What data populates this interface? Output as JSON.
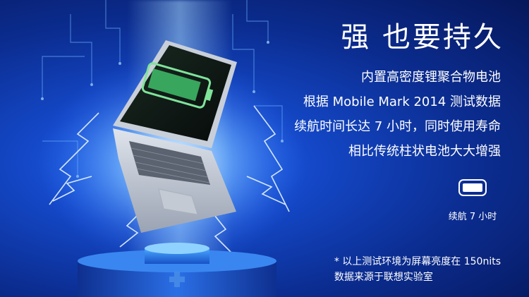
{
  "headline": "强 也要持久",
  "features": [
    "内置高密度锂聚合物电池",
    "根据 Mobile Mark 2014 测试数据",
    "续航时间长达 7 小时，同时使用寿命",
    "相比传统柱状电池大大增强"
  ],
  "battery_badge": {
    "icon": "battery-icon",
    "label": "续航 7 小时",
    "level": 1.0
  },
  "footnote": [
    "* 以上测试环境为屏幕亮度在 150nits",
    "数据来源于联想实验室"
  ],
  "colors": {
    "background_deep": "#06175a",
    "background_mid": "#1448c8",
    "glow": "#8fd2ff",
    "text": "#ffffff"
  }
}
